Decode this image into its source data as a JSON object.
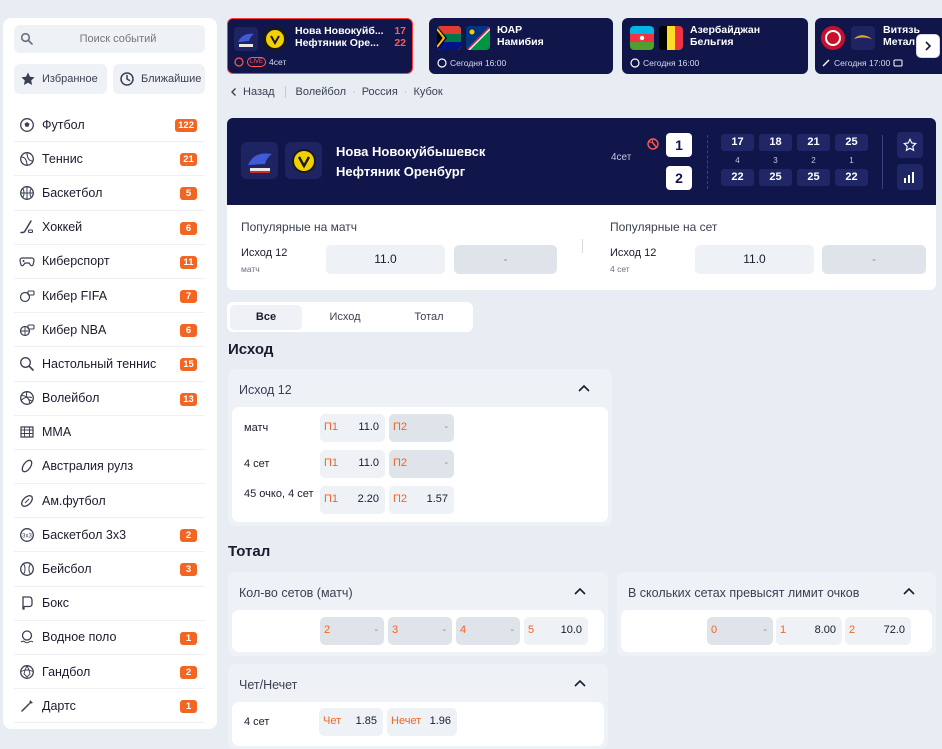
{
  "search": {
    "placeholder": "Поиск событий"
  },
  "quick": {
    "favorites": "Избранное",
    "upcoming": "Ближайшие"
  },
  "sports": [
    {
      "name": "Футбол",
      "count": "122",
      "icon": "soccer-ball-icon"
    },
    {
      "name": "Теннис",
      "count": "21",
      "icon": "tennis-ball-icon"
    },
    {
      "name": "Баскетбол",
      "count": "5",
      "icon": "basketball-icon"
    },
    {
      "name": "Хоккей",
      "count": "6",
      "icon": "hockey-stick-icon"
    },
    {
      "name": "Киберспорт",
      "count": "11",
      "icon": "gamepad-icon"
    },
    {
      "name": "Кибер FIFA",
      "count": "7",
      "icon": "cyber-fifa-icon"
    },
    {
      "name": "Кибер NBA",
      "count": "6",
      "icon": "cyber-nba-icon"
    },
    {
      "name": "Настольный теннис",
      "count": "15",
      "icon": "table-tennis-icon"
    },
    {
      "name": "Волейбол",
      "count": "13",
      "icon": "volleyball-icon"
    },
    {
      "name": "MMA",
      "count": "",
      "icon": "mma-icon"
    },
    {
      "name": "Австралия рулз",
      "count": "",
      "icon": "aussie-rules-icon"
    },
    {
      "name": "Ам.футбол",
      "count": "",
      "icon": "american-football-icon"
    },
    {
      "name": "Баскетбол 3х3",
      "count": "2",
      "icon": "basketball-3x3-icon"
    },
    {
      "name": "Бейсбол",
      "count": "3",
      "icon": "baseball-icon"
    },
    {
      "name": "Бокс",
      "count": "",
      "icon": "boxing-icon"
    },
    {
      "name": "Водное поло",
      "count": "1",
      "icon": "water-polo-icon"
    },
    {
      "name": "Гандбол",
      "count": "2",
      "icon": "handball-icon"
    },
    {
      "name": "Дартс",
      "count": "1",
      "icon": "darts-icon"
    }
  ],
  "top_events": [
    {
      "team1": "Нова Новокуйб...",
      "team2": "Нефтяник Оре...",
      "score1": "17",
      "score2": "22",
      "meta": "4сет",
      "live": "LIVE"
    },
    {
      "team1": "ЮАР",
      "team2": "Намибия",
      "meta": "Сегодня 16:00"
    },
    {
      "team1": "Азербайджан",
      "team2": "Бельгия",
      "meta": "Сегодня 16:00"
    },
    {
      "team1": "Витязь",
      "team2": "Метал",
      "meta": "Сегодня 17:00"
    }
  ],
  "breadcrumbs": {
    "back": "Назад",
    "sport": "Волейбол",
    "country": "Россия",
    "league": "Кубок"
  },
  "match": {
    "team1": "Нова Новокуйбышевск",
    "team2": "Нефтяник Оренбург",
    "set_label": "4сет",
    "score1": "1",
    "score2": "2",
    "sets_t1": [
      "17",
      "18",
      "21",
      "25"
    ],
    "sets_t2": [
      "22",
      "25",
      "25",
      "22"
    ],
    "set_numbers": [
      "4",
      "3",
      "2",
      "1"
    ]
  },
  "popular": {
    "match_title": "Популярные на матч",
    "set_title": "Популярные на сет",
    "match_market": "Исход 12",
    "match_sub": "матч",
    "match_odd": "11.0",
    "match_odd2": "-",
    "set_market": "Исход 12",
    "set_sub": "4 сет",
    "set_odd": "11.0",
    "set_odd2": "-"
  },
  "tabs": [
    "Все",
    "Исход",
    "Тотал"
  ],
  "sections": {
    "outcome": "Исход",
    "total": "Тотал"
  },
  "outcome_market": {
    "title": "Исход 12",
    "rows": [
      {
        "label": "матч",
        "k1": "П1",
        "v1": "11.0",
        "k2": "П2",
        "v2": "-"
      },
      {
        "label": "4 сет",
        "k1": "П1",
        "v1": "11.0",
        "k2": "П2",
        "v2": "-"
      },
      {
        "label": "45 очко, 4 сет",
        "k1": "П1",
        "v1": "2.20",
        "k2": "П2",
        "v2": "1.57"
      }
    ]
  },
  "sets_market": {
    "title": "Кол-во сетов (матч)",
    "odds": [
      {
        "k": "2",
        "v": "-"
      },
      {
        "k": "3",
        "v": "-"
      },
      {
        "k": "4",
        "v": "-"
      },
      {
        "k": "5",
        "v": "10.0"
      }
    ]
  },
  "limit_market": {
    "title": "В скольких сетах превысят лимит очков",
    "odds": [
      {
        "k": "0",
        "v": "-"
      },
      {
        "k": "1",
        "v": "8.00"
      },
      {
        "k": "2",
        "v": "72.0"
      }
    ]
  },
  "parity_market": {
    "title": "Чет/Нечет",
    "label": "4 сет",
    "k1": "Чет",
    "v1": "1.85",
    "k2": "Нечет",
    "v2": "1.96"
  },
  "colors": {
    "accent": "#f26522",
    "navy": "#10154a",
    "live": "#ff5a4e"
  }
}
